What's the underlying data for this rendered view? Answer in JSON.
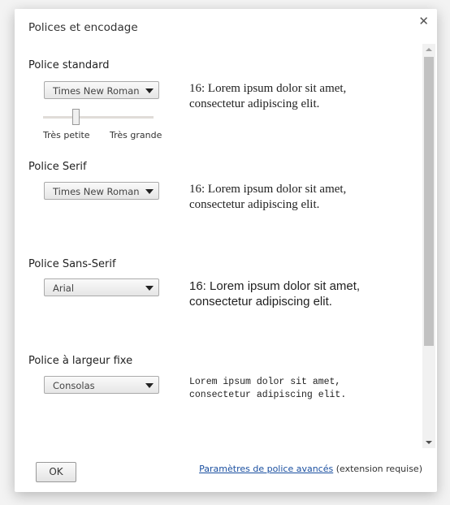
{
  "dialog": {
    "title": "Polices et encodage",
    "close_icon": "close-icon"
  },
  "sections": [
    {
      "label": "Police standard",
      "font": "Times New Roman",
      "preview": "16: Lorem ipsum dolor sit amet, consectetur adipiscing elit."
    },
    {
      "label": "Police Serif",
      "font": "Times New Roman",
      "preview": "16: Lorem ipsum dolor sit amet, consectetur adipiscing elit."
    },
    {
      "label": "Police Sans-Serif",
      "font": "Arial",
      "preview": "16: Lorem ipsum dolor sit amet, consectetur adipiscing elit."
    },
    {
      "label": "Police à largeur fixe",
      "font": "Consolas",
      "preview": "Lorem ipsum dolor sit amet, consectetur adipiscing elit."
    }
  ],
  "size_slider": {
    "min_label": "Très petite",
    "max_label": "Très grande",
    "value_fraction": 0.3
  },
  "footer": {
    "ok_label": "OK",
    "advanced_link": "Paramètres de police avancés",
    "advanced_note": "(extension requise)"
  },
  "colors": {
    "link": "#1a4fa0"
  }
}
